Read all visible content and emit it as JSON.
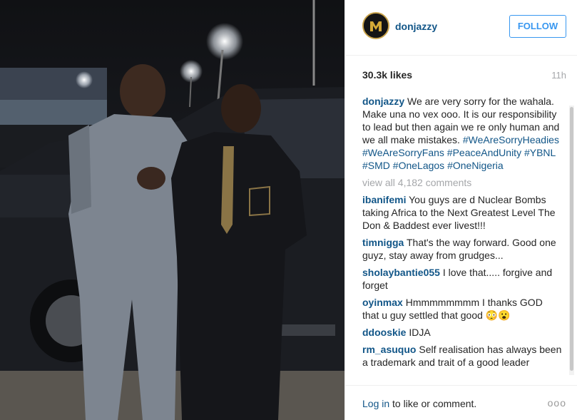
{
  "post": {
    "username": "donjazzy",
    "follow_label": "FOLLOW",
    "likes": "30.3k likes",
    "time": "11h"
  },
  "caption": {
    "user": "donjazzy",
    "text": "We are very sorry for the wahala. Make una no vex ooo. It is our responsibility to lead but then again we re only human and we all make mistakes.",
    "tags": "#WeAreSorryHeadies #WeAreSorryFans #PeaceAndUnity #YBNL #SMD #OneLagos #OneNigeria"
  },
  "view_all": "view all 4,182 comments",
  "comments": [
    {
      "user": "ibanifemi",
      "text": "You guys are d Nuclear Bombs taking Africa to the Next Greatest Level The Don & Baddest ever livest!!!"
    },
    {
      "user": "timnigga",
      "text": "That's the way forward. Good one guyz, stay away from grudges..."
    },
    {
      "user": "sholaybantie055",
      "text": "I love that..... forgive and forget"
    },
    {
      "user": "oyinmax",
      "text": "Hmmmmmmmm I thanks GOD that u guy settled that good 😳😮"
    },
    {
      "user": "ddooskie",
      "text": "IDJA"
    },
    {
      "user": "rm_asuquo",
      "text": "Self realisation has always been a trademark and trait of a good leader"
    }
  ],
  "footer": {
    "login_link": "Log in",
    "login_rest": " to like or comment.",
    "more": "ooo"
  },
  "icons": {
    "avatar": "avatar-logo-icon",
    "more": "more-options-icon"
  },
  "colors": {
    "link": "#125688",
    "follow": "#3897f0",
    "muted": "#a5a7aa"
  }
}
